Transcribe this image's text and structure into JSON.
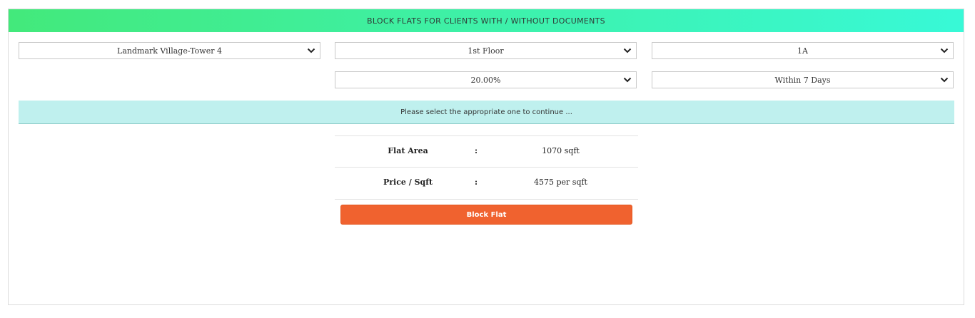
{
  "header": {
    "title": "BLOCK FLATS FOR CLIENTS WITH / WITHOUT DOCUMENTS"
  },
  "selects": {
    "project": "Landmark Village-Tower 4",
    "floor": "1st Floor",
    "flat": "1A",
    "percentage": "20.00%",
    "duration": "Within 7 Days"
  },
  "notice": {
    "text": "Please select the appropriate one to continue ..."
  },
  "info": {
    "rows": [
      {
        "label": "Flat Area",
        "separator": ":",
        "value": "1070 sqft"
      },
      {
        "label": "Price / Sqft",
        "separator": ":",
        "value": "4575 per sqft"
      }
    ]
  },
  "actions": {
    "block_label": "Block Flat"
  },
  "colors": {
    "header_start": "#43e97b",
    "header_end": "#38f9d7",
    "notice_bg": "#bff0ee",
    "button_bg": "#f0622f"
  },
  "icons": {
    "select_arrow": "chevron-down-icon"
  }
}
